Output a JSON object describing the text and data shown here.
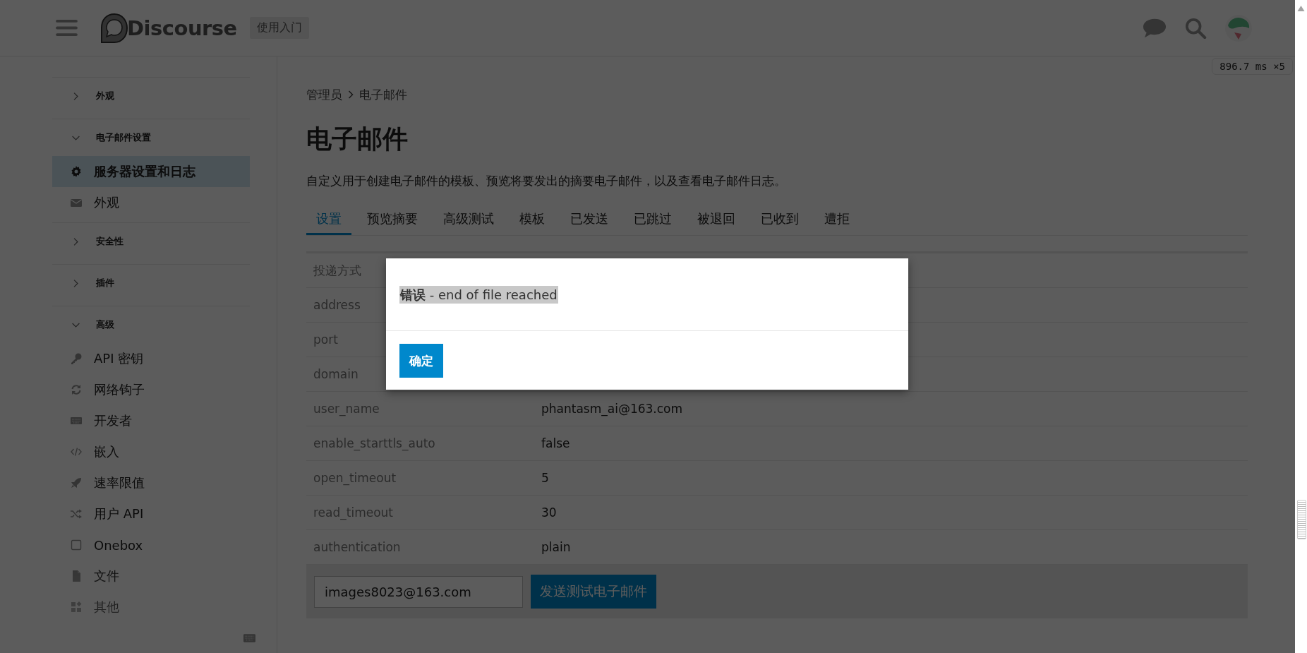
{
  "header": {
    "logo": "Discourse",
    "getting_started": "使用入门"
  },
  "perf_badge": "896.7 ms ×5",
  "sidebar": {
    "sections": [
      {
        "label": "外观",
        "expanded": false
      },
      {
        "label": "电子邮件设置",
        "expanded": true,
        "children": [
          {
            "label": "服务器设置和日志",
            "selected": true
          },
          {
            "label": "外观",
            "selected": false
          }
        ]
      },
      {
        "label": "安全性",
        "expanded": false
      },
      {
        "label": "插件",
        "expanded": false
      },
      {
        "label": "高级",
        "expanded": true,
        "children": [
          {
            "label": "API 密钥",
            "selected": false
          },
          {
            "label": "网络钩子",
            "selected": false
          },
          {
            "label": "开发者",
            "selected": false
          },
          {
            "label": "嵌入",
            "selected": false
          },
          {
            "label": "速率限值",
            "selected": false
          },
          {
            "label": "用户 API",
            "selected": false
          },
          {
            "label": "Onebox",
            "selected": false
          },
          {
            "label": "文件",
            "selected": false
          },
          {
            "label": "其他",
            "selected": false
          }
        ]
      }
    ]
  },
  "breadcrumb": [
    "管理员",
    "电子邮件"
  ],
  "title": "电子邮件",
  "description": "自定义用于创建电子邮件的模板、预览将要发出的摘要电子邮件，以及查看电子邮件日志。",
  "tabs": [
    {
      "label": "设置",
      "selected": true
    },
    {
      "label": "预览摘要",
      "selected": false
    },
    {
      "label": "高级测试",
      "selected": false
    },
    {
      "label": "模板",
      "selected": false
    },
    {
      "label": "已发送",
      "selected": false
    },
    {
      "label": "已跳过",
      "selected": false
    },
    {
      "label": "被退回",
      "selected": false
    },
    {
      "label": "已收到",
      "selected": false
    },
    {
      "label": "遭拒",
      "selected": false
    }
  ],
  "settings": [
    {
      "name": "投递方式"
    },
    {
      "name": "address"
    },
    {
      "name": "port"
    },
    {
      "name": "domain"
    },
    {
      "name": "user_name",
      "value": "phantasm_ai@163.com"
    },
    {
      "name": "enable_starttls_auto",
      "value": "false"
    },
    {
      "name": "open_timeout",
      "value": "5"
    },
    {
      "name": "read_timeout",
      "value": "30"
    },
    {
      "name": "authentication",
      "value": "plain"
    }
  ],
  "test_email": {
    "value": "images8023@163.com",
    "button": "发送测试电子邮件"
  },
  "dialog": {
    "message": "**错误** - end of file reached",
    "button": "确定"
  }
}
